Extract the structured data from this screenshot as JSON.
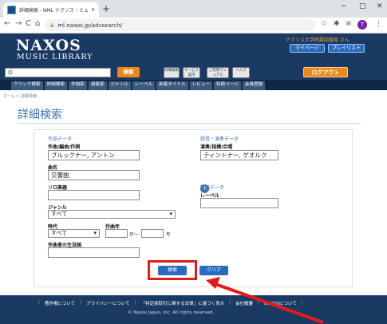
{
  "browser": {
    "tab_title": "詳細検索 - NML ナクソス・ミュージック",
    "tab_close": "×",
    "new_tab": "+",
    "win_min": "−",
    "win_max": "□",
    "win_close": "✕",
    "back": "←",
    "forward": "→",
    "reload": "C",
    "home": "⌂",
    "lock": "🔒",
    "url": "ml.naxos.jp/advsearch/",
    "star": "☆",
    "profile_initial": "T",
    "menu": "⋮"
  },
  "header": {
    "logo_line1": "NAXOS",
    "logo_line2": "MUSIC LIBRARY",
    "search_icon": "Q",
    "search_button": "検索",
    "buttons": [
      "詳細検索",
      "サービス案内",
      "ご利用マニュアル",
      "ヘルプ"
    ],
    "user_text": "ナクソス大学附属図書館 さん",
    "mypage": "マイページ",
    "playlist": "プレイリスト",
    "logout": "ログアウト"
  },
  "nav": [
    "クリック検索",
    "詳細検索",
    "作曲家",
    "演奏家",
    "ジャンル",
    "レーベル",
    "新着タイトル",
    "レビュー",
    "特設ページ",
    "会員登録"
  ],
  "breadcrumb": "ホーム > 詳細検索",
  "page_title": "詳細検索",
  "form": {
    "work_section": "作品データ",
    "composer_label": "作曲/編曲/作詞",
    "composer_value": "ブルックナー, アントン",
    "title_label": "曲名",
    "title_value": "交響曲",
    "solo_label": "ソロ楽器",
    "solo_value": "",
    "genre_label": "ジャンル",
    "genre_value": "すべて",
    "era_label": "時代",
    "era_value": "すべて",
    "year_label": "作曲年",
    "year_from_suffix": "年〜",
    "year_to_suffix": "年",
    "birthplace_label": "作曲者の生没国",
    "perf_section": "録音・演奏データ",
    "performer_label": "演奏/指揮/合唱",
    "performer_value": "ティントナー, ゲオルク",
    "add_icon": "+",
    "product_section": "製品データ",
    "label_label": "レーベル",
    "label_value": "",
    "search_button": "検索",
    "clear_button": "クリア",
    "dropdown_arrow": "▾"
  },
  "footer": {
    "links": [
      "著作権について",
      "プライバシーについて",
      "「特定商取引に関する法律」に基づく表示",
      "会社概要",
      "NAXOSについて"
    ],
    "copyright": "© Naxos Japan, Inc. All rights reserved."
  },
  "colors": {
    "header_bg": "#1a3a63",
    "accent_orange": "#e88a1a",
    "button_blue": "#2a6dbf",
    "highlight_red": "#e21b1b"
  }
}
